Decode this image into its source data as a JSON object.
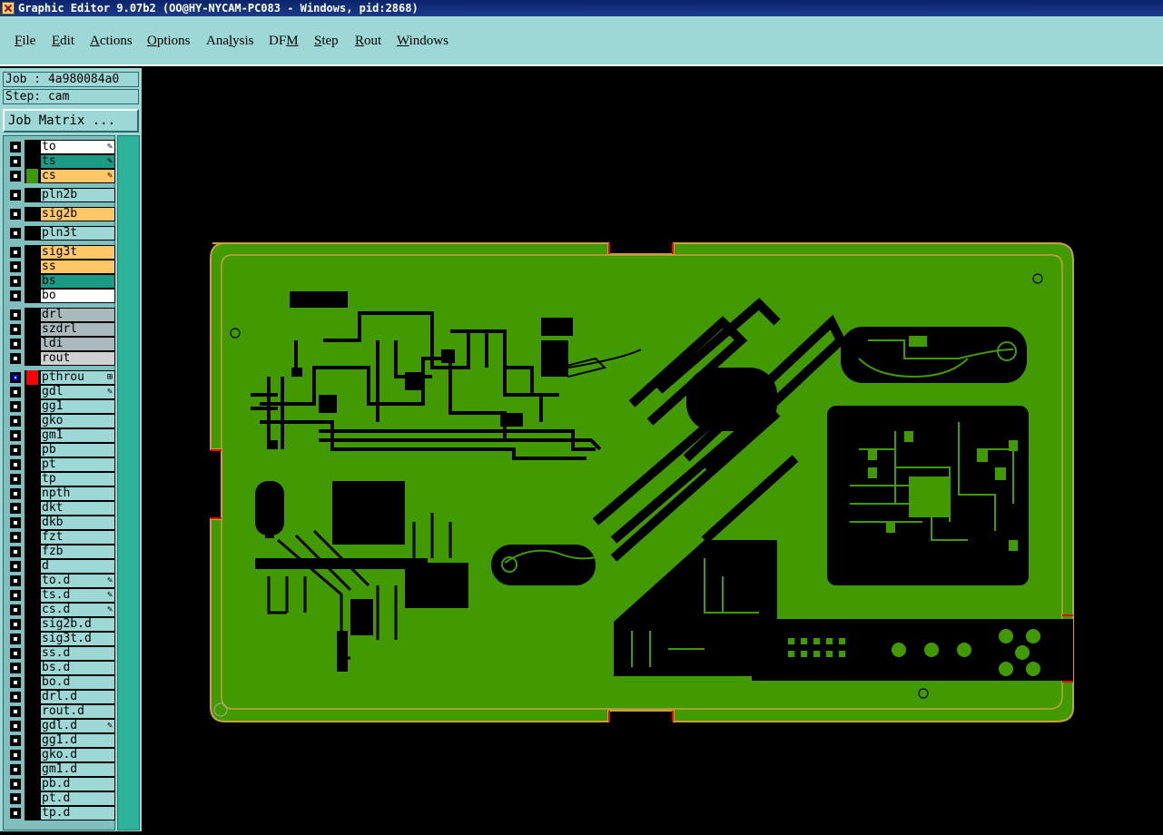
{
  "window": {
    "title": "Graphic Editor 9.07b2 (OO@HY-NYCAM-PC083 - Windows, pid:2868)"
  },
  "menu": [
    {
      "pre": "",
      "u": "F",
      "post": "ile"
    },
    {
      "pre": "",
      "u": "E",
      "post": "dit"
    },
    {
      "pre": "",
      "u": "A",
      "post": "ctions"
    },
    {
      "pre": "",
      "u": "O",
      "post": "ptions"
    },
    {
      "pre": "Ana",
      "u": "l",
      "post": "ysis"
    },
    {
      "pre": "DF",
      "u": "M",
      "post": ""
    },
    {
      "pre": "",
      "u": "S",
      "post": "tep"
    },
    {
      "pre": "",
      "u": "R",
      "post": "out"
    },
    {
      "pre": "",
      "u": "W",
      "post": "indows"
    }
  ],
  "info": {
    "job": "Job : 4a980084a0",
    "step": "Step: cam",
    "job_matrix": "Job Matrix ..."
  },
  "colors": {
    "gold": "#ffc766",
    "teal": "#1b9a85",
    "white": "#ffffff",
    "gray": "#a9b9bc",
    "light": "#d0d0d0",
    "base": "#9dd8d6",
    "board": "#419a00",
    "outline": "#c8a040"
  },
  "layers": [
    {
      "name": "to",
      "color": "white",
      "mark": "✎"
    },
    {
      "name": "ts",
      "color": "teal",
      "mark": "✎"
    },
    {
      "name": "cs",
      "color": "gold",
      "mark": "✎",
      "swatch": "#3a9a00"
    },
    {
      "name": "pln2b",
      "gap": true
    },
    {
      "name": "sig2b",
      "color": "gold",
      "gap": true
    },
    {
      "name": "pln3t",
      "gap": true
    },
    {
      "name": "sig3t",
      "color": "gold",
      "gap": true
    },
    {
      "name": "ss",
      "color": "gold"
    },
    {
      "name": "bs",
      "color": "teal"
    },
    {
      "name": "bo",
      "color": "white"
    },
    {
      "name": "drl",
      "color": "gray",
      "gap": true
    },
    {
      "name": "szdrl",
      "color": "gray"
    },
    {
      "name": "ldi",
      "color": "gray"
    },
    {
      "name": "rout",
      "color": "light"
    },
    {
      "name": "pthrou",
      "gap": true,
      "checked": true,
      "swatch": "#ff0000",
      "mark": "⊞"
    },
    {
      "name": "gdl",
      "mark": "✎"
    },
    {
      "name": "gg1"
    },
    {
      "name": "gko"
    },
    {
      "name": "gm1"
    },
    {
      "name": "pb"
    },
    {
      "name": "pt"
    },
    {
      "name": "tp"
    },
    {
      "name": "npth"
    },
    {
      "name": "dkt"
    },
    {
      "name": "dkb"
    },
    {
      "name": "fzt"
    },
    {
      "name": "fzb"
    },
    {
      "name": "d"
    },
    {
      "name": "to.d",
      "mark": "✎"
    },
    {
      "name": "ts.d",
      "mark": "✎"
    },
    {
      "name": "cs.d",
      "mark": "✎"
    },
    {
      "name": "sig2b.d"
    },
    {
      "name": "sig3t.d"
    },
    {
      "name": "ss.d"
    },
    {
      "name": "bs.d"
    },
    {
      "name": "bo.d"
    },
    {
      "name": "drl.d"
    },
    {
      "name": "rout.d"
    },
    {
      "name": "gdl.d",
      "mark": "✎"
    },
    {
      "name": "gg1.d"
    },
    {
      "name": "gko.d"
    },
    {
      "name": "gm1.d"
    },
    {
      "name": "pb.d"
    },
    {
      "name": "pt.d"
    },
    {
      "name": "tp.d"
    }
  ]
}
